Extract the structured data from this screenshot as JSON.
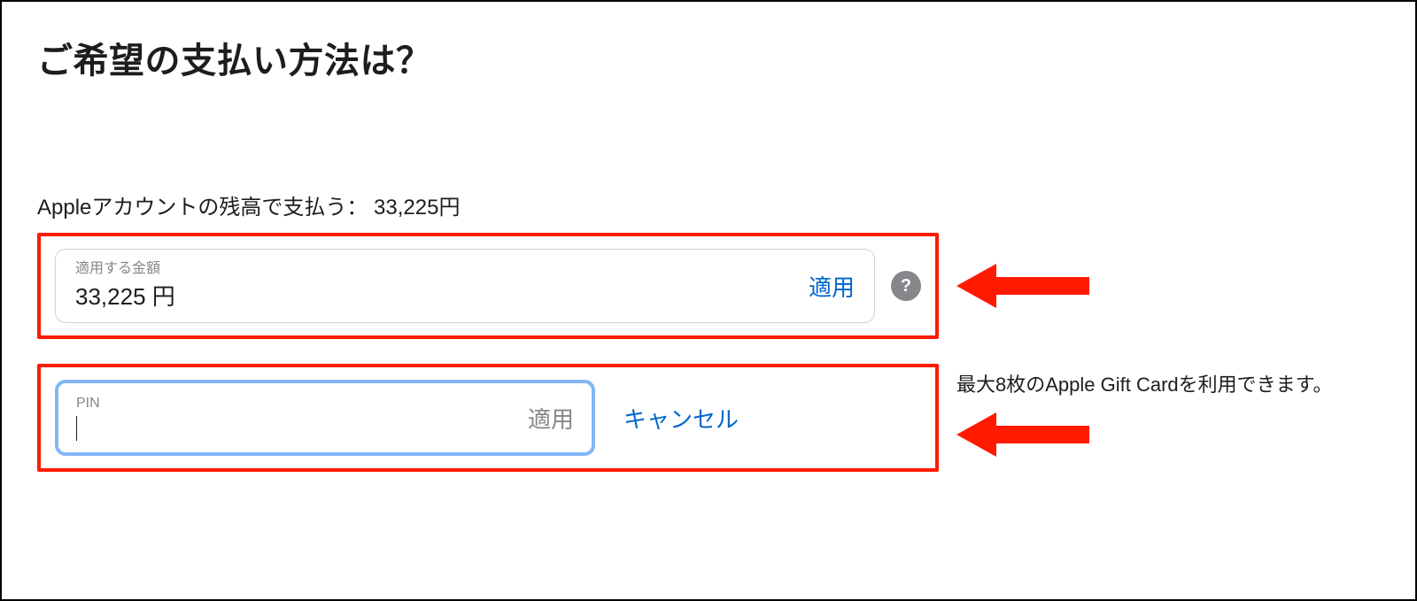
{
  "heading": "ご希望の支払い方法は？",
  "balance": {
    "label": "Appleアカウントの残高で支払う： 33,225円"
  },
  "amount_card": {
    "floating_label": "適用する金額",
    "value": "33,225 円",
    "apply_label": "適用",
    "help_glyph": "?"
  },
  "pin_card": {
    "floating_label": "PIN",
    "apply_label": "適用",
    "cancel_label": "キャンセル"
  },
  "gift_note": "最大8枚のApple Gift Cardを利用できます。"
}
